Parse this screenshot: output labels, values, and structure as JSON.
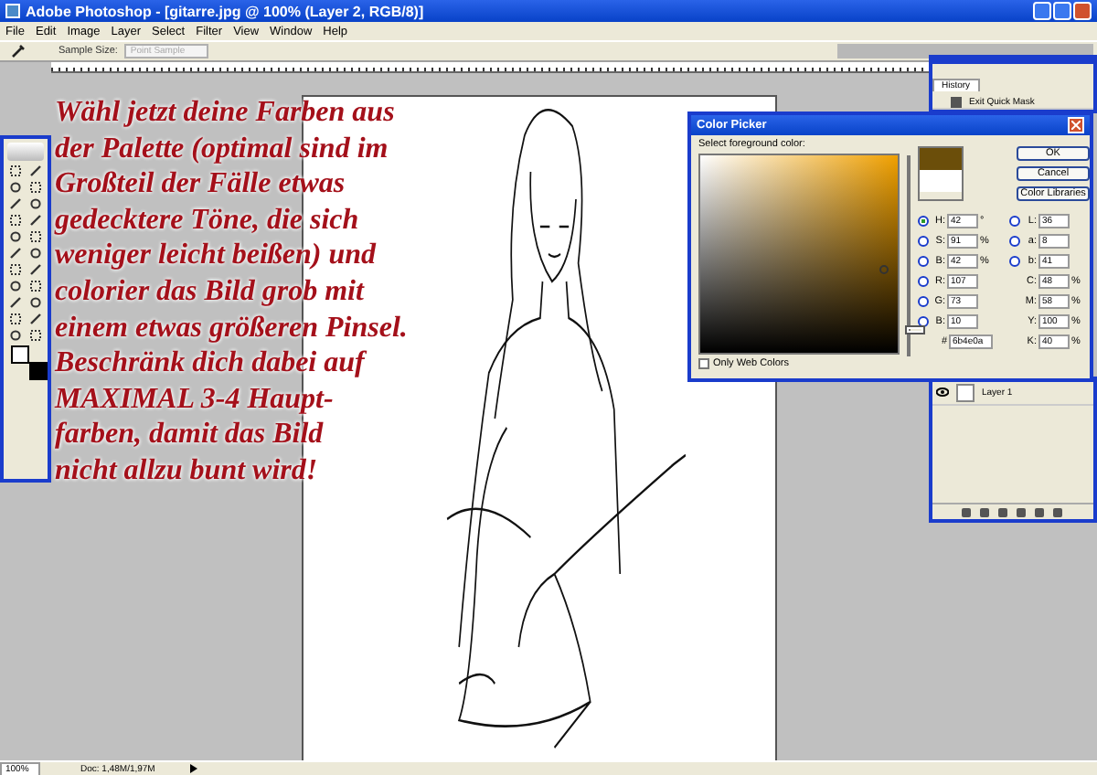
{
  "window": {
    "title": "Adobe Photoshop - [gitarre.jpg @ 100% (Layer 2, RGB/8)]"
  },
  "menu": [
    "File",
    "Edit",
    "Image",
    "Layer",
    "Select",
    "Filter",
    "View",
    "Window",
    "Help"
  ],
  "options_bar": {
    "label": "Sample Size:",
    "value": "Point Sample"
  },
  "overlay_text": {
    "lines": [
      "Wähl jetzt deine Farben aus",
      "der Palette (optimal sind im",
      "Großteil der Fälle etwas",
      "gedecktere Töne, die sich",
      "weniger leicht beißen) und",
      "colorier das Bild grob mit",
      "einem etwas größeren Pinsel.",
      "Beschränk dich dabei auf",
      "MAXIMAL 3-4 Haupt-",
      "farben, damit das Bild",
      "nicht allzu bunt wird!"
    ]
  },
  "history": {
    "title": "History",
    "items": [
      {
        "label": "Exit Quick Mask"
      }
    ]
  },
  "color_picker": {
    "title": "Color Picker",
    "prompt": "Select foreground color:",
    "buttons": [
      "OK",
      "Cancel",
      "Color Libraries"
    ],
    "hue_slider": {
      "level": 0.12
    },
    "left_fields": [
      {
        "kind": "radio",
        "label": "H:",
        "value": "42",
        "unit": "°",
        "selected": true
      },
      {
        "kind": "radio",
        "label": "S:",
        "value": "91",
        "unit": "%",
        "selected": false
      },
      {
        "kind": "radio",
        "label": "B:",
        "value": "42",
        "unit": "%",
        "selected": false
      },
      {
        "kind": "radio",
        "label": "R:",
        "value": "107",
        "selected": false
      },
      {
        "kind": "radio",
        "label": "G:",
        "value": "73",
        "selected": false
      },
      {
        "kind": "radio",
        "label": "B:",
        "value": "10",
        "selected": false
      }
    ],
    "right_fields": [
      {
        "kind": "radio",
        "label": "L:",
        "value": "36",
        "selected": false
      },
      {
        "kind": "radio",
        "label": "a:",
        "value": "8",
        "selected": false
      },
      {
        "kind": "radio",
        "label": "b:",
        "value": "41",
        "selected": false
      },
      {
        "kind": "plain",
        "label": "C:",
        "value": "48",
        "unit": "%"
      },
      {
        "kind": "plain",
        "label": "M:",
        "value": "58",
        "unit": "%"
      },
      {
        "kind": "plain",
        "label": "Y:",
        "value": "100",
        "unit": "%"
      },
      {
        "kind": "plain",
        "label": "K:",
        "value": "40",
        "unit": "%"
      }
    ],
    "hex": {
      "label": "#",
      "value": "6b4e0a"
    },
    "web_colors": {
      "label": "Only Web Colors",
      "checked": false
    }
  },
  "layers": {
    "items": [
      {
        "name": "Layer 1",
        "visible": true
      }
    ]
  },
  "status_bar": {
    "zoom": "100%",
    "doc": "Doc: 1,48M/1,97M"
  }
}
